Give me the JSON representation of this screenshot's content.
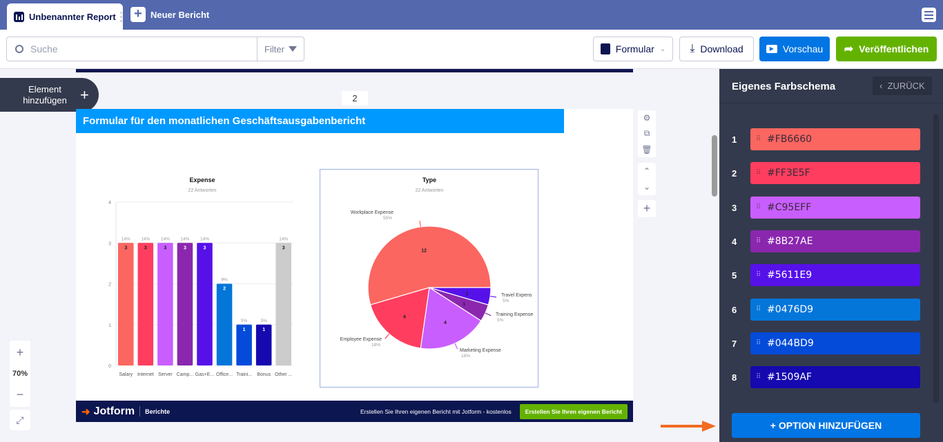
{
  "tabs": [
    {
      "label": "Unbenannter Report"
    },
    {
      "label": "Neuer Bericht"
    }
  ],
  "toolbar": {
    "search_placeholder": "Suche",
    "filter": "Filter",
    "formular": "Formular",
    "download": "Download",
    "preview": "Vorschau",
    "publish": "Veröffentlichen"
  },
  "canvas": {
    "add_element": "Element hinzufügen",
    "page_number": "2",
    "zoom": "70%"
  },
  "report": {
    "title": "Formular für den monatlichen Geschäftsausgabenbericht",
    "footer": {
      "brand": "Jotform",
      "section": "Berichte",
      "cta_text": "Erstellen Sie Ihren eigenen Bericht mit Jotform - kostenlos",
      "cta_button": "Erstellen Sie Ihren eigenen Bericht"
    }
  },
  "chart_data": [
    {
      "type": "bar",
      "title": "Expense",
      "subtitle": "22 Antworten",
      "ylim": [
        0,
        4
      ],
      "yticks": [
        "0",
        "1",
        "2",
        "3",
        "4"
      ],
      "categories": [
        "Salary",
        "Internet",
        "Server",
        "Camp...",
        "Gas+E...",
        "Office...",
        "Traini...",
        "Bonus",
        "Other ..."
      ],
      "values": [
        3,
        3,
        3,
        3,
        3,
        2,
        1,
        1,
        3
      ],
      "percent_labels": [
        "14%",
        "14%",
        "14%",
        "14%",
        "14%",
        "9%",
        "5%",
        "5%",
        "14%"
      ],
      "colors": [
        "#FB6660",
        "#FF3E5F",
        "#C95EFF",
        "#8B27AE",
        "#5611E9",
        "#0476D9",
        "#044BD9",
        "#1509AF",
        "#CCCCCC"
      ],
      "grid": true
    },
    {
      "type": "pie",
      "title": "Type",
      "subtitle": "22 Antworten",
      "categories": [
        "Workplace Expense",
        "Employee Expense",
        "Marketing Expense",
        "Training Expense",
        "Travel Expense"
      ],
      "display_labels": [
        "Workplace Expense",
        "Employee Expense",
        "Marketing Expense",
        "Training Expense",
        "Travel Expens"
      ],
      "values": [
        12,
        4,
        4,
        1,
        1
      ],
      "percent_labels": [
        "55%",
        "18%",
        "18%",
        "5%",
        "5%"
      ],
      "colors": [
        "#FB6660",
        "#FF3E5F",
        "#C95EFF",
        "#8B27AE",
        "#5611E9"
      ]
    }
  ],
  "panel": {
    "title": "Eigenes Farbschema",
    "back": "ZURÜCK",
    "add_option": "+ OPTION HINZUFÜGEN",
    "colors": [
      {
        "n": "1",
        "hex": "#FB6660",
        "text": "#3a2a3a"
      },
      {
        "n": "2",
        "hex": "#FF3E5F",
        "text": "#3a2a3a"
      },
      {
        "n": "3",
        "hex": "#C95EFF",
        "text": "#3a2a3a"
      },
      {
        "n": "4",
        "hex": "#8B27AE",
        "text": "#ffffff"
      },
      {
        "n": "5",
        "hex": "#5611E9",
        "text": "#ffffff"
      },
      {
        "n": "6",
        "hex": "#0476D9",
        "text": "#ffffff"
      },
      {
        "n": "7",
        "hex": "#044BD9",
        "text": "#ffffff"
      },
      {
        "n": "8",
        "hex": "#1509AF",
        "text": "#ffffff"
      }
    ]
  },
  "annotation": {
    "arrow_color": "#F26B21"
  }
}
